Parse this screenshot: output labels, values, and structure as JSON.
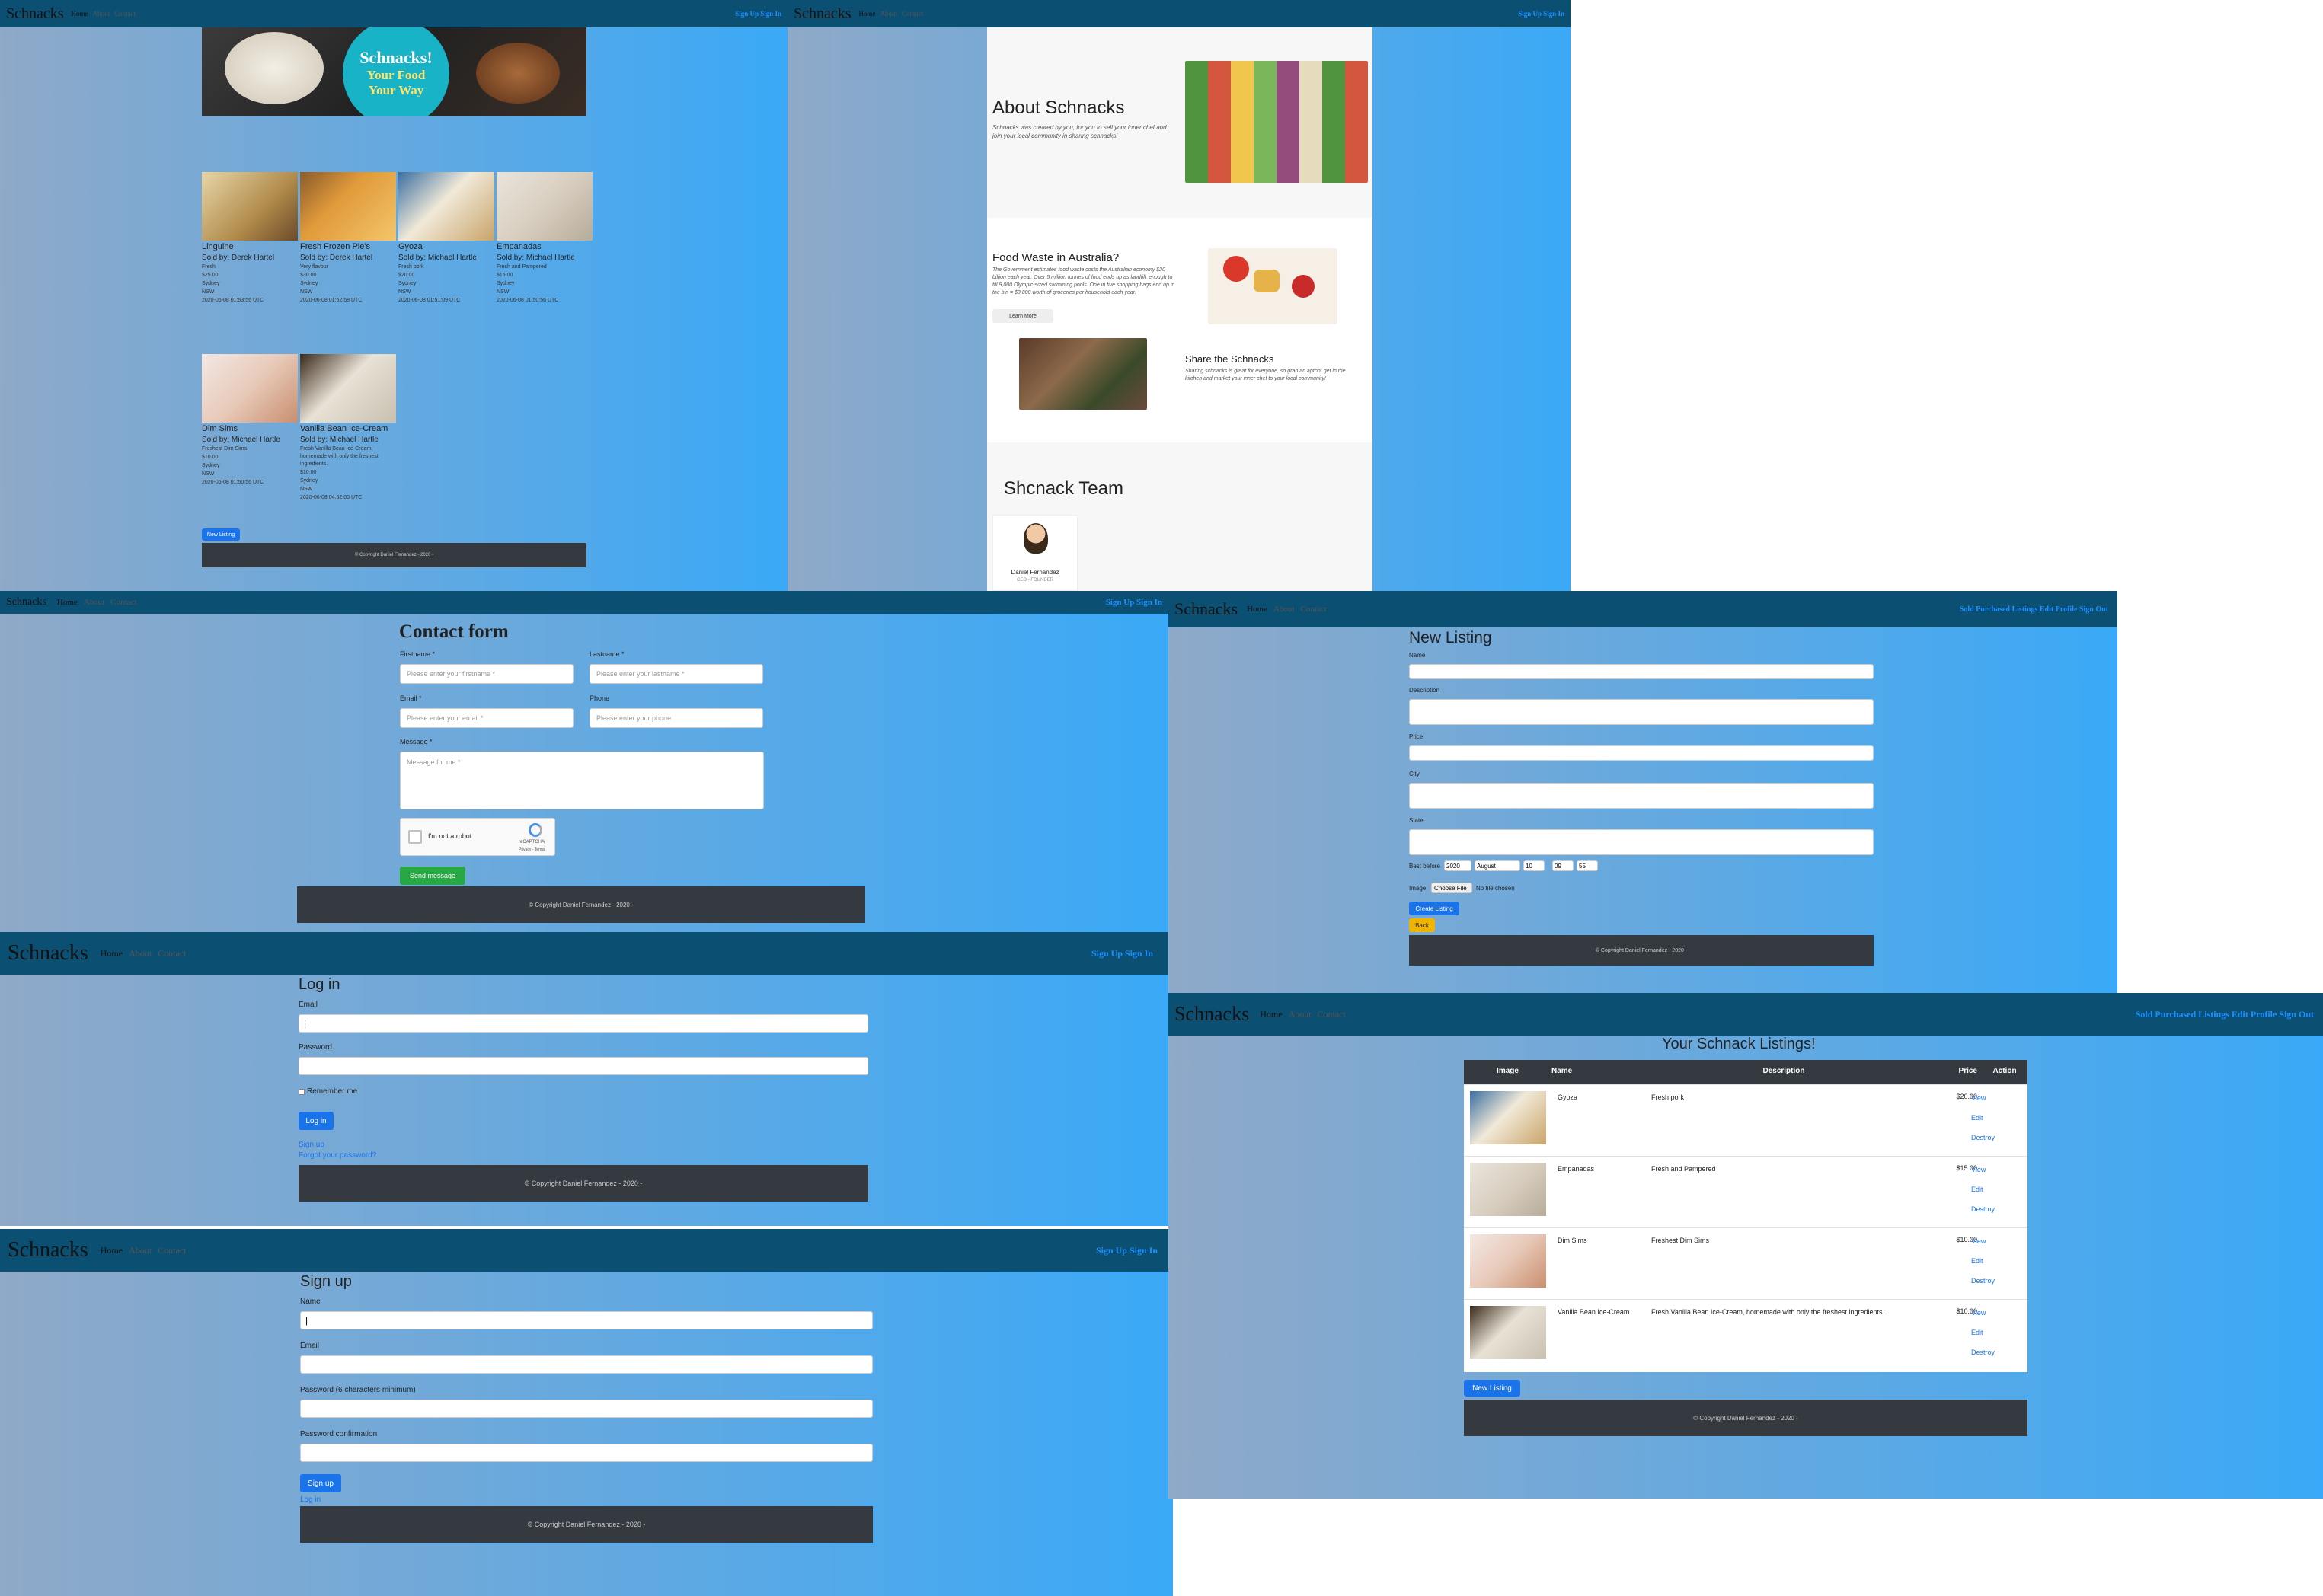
{
  "brand": "Schnacks",
  "nav": {
    "home": "Home",
    "about": "About",
    "contact": "Contact",
    "signup": "Sign Up",
    "signin": "Sign In",
    "auth_links": "Sign Up Sign In",
    "user_links": "Sold Purchased Listings Edit Profile Sign Out"
  },
  "home": {
    "banner_line1": "Schnacks!",
    "banner_line2": "Your Food",
    "banner_line3": "Your Way",
    "listings": [
      {
        "name": "Linguine",
        "seller": "Sold by: Derek Hartel",
        "desc": "Fresh",
        "price": "$25.00",
        "city": "Sydney",
        "state": "NSW",
        "date": "2020-06-08 01:53:56 UTC"
      },
      {
        "name": "Fresh Frozen Pie's",
        "seller": "Sold by: Derek Hartel",
        "desc": "Very flavour",
        "price": "$30.00",
        "city": "Sydney",
        "state": "NSW",
        "date": "2020-06-08 01:52:58 UTC"
      },
      {
        "name": "Gyoza",
        "seller": "Sold by: Michael Hartle",
        "desc": "Fresh pork",
        "price": "$20.00",
        "city": "Sydney",
        "state": "NSW",
        "date": "2020-06-08 01:51:09 UTC"
      },
      {
        "name": "Empanadas",
        "seller": "Sold by: Michael Hartle",
        "desc": "Fresh and Pampered",
        "price": "$15.00",
        "city": "Sydney",
        "state": "NSW",
        "date": "2020-06-08 01:50:56 UTC"
      },
      {
        "name": "Dim Sims",
        "seller": "Sold by: Michael Hartle",
        "desc": "Freshest Dim Sims",
        "price": "$10.00",
        "city": "Sydney",
        "state": "NSW",
        "date": "2020-06-08 01:50:56 UTC"
      },
      {
        "name": "Vanilla Bean Ice-Cream",
        "seller": "Sold by: Michael Hartle",
        "desc": "Fresh Vanilla Bean Ice-Cream, homemade with only the freshest ingredients.",
        "price": "$10.00",
        "city": "Sydney",
        "state": "NSW",
        "date": "2020-06-08 04:52:00 UTC"
      }
    ],
    "new_listing": "New Listing",
    "footer": "© Copyright Daniel Fernandez - 2020 -"
  },
  "about": {
    "title": "About Schnacks",
    "intro": "Schnacks was created by you, for you to sell your inner chef and join your local community in sharing schnacks!",
    "waste_title": "Food Waste in Australia?",
    "waste_text": "The Government estimates food waste costs the Australian economy $20 billion each year. Over 5 million tonnes of food ends up as landfill, enough to fill 9,000 Olympic-sized swimming pools. One in five shopping bags end up in the bin = $3,800 worth of groceries per household each year.",
    "learn_more": "Learn More",
    "share_title": "Share the Schnacks",
    "share_text": "Sharing schnacks is great for everyone, so grab an apron, get in the kitchen and market your inner chef to your local community!",
    "team_title": "Shcnack Team",
    "member_name": "Daniel Fernandez",
    "member_role": "CEO - FOUNDER"
  },
  "contact": {
    "title": "Contact form",
    "firstname_label": "Firstname *",
    "firstname_ph": "Please enter your firstname *",
    "lastname_label": "Lastname *",
    "lastname_ph": "Please enter your lastname *",
    "email_label": "Email *",
    "email_ph": "Please enter your email *",
    "phone_label": "Phone",
    "phone_ph": "Please enter your phone",
    "message_label": "Message *",
    "message_ph": "Message for me *",
    "captcha": "I'm not a robot",
    "captcha_brand": "reCAPTCHA",
    "captcha_terms": "Privacy - Terms",
    "send": "Send message"
  },
  "login": {
    "title": "Log in",
    "email": "Email",
    "password": "Password",
    "remember": "Remember me",
    "submit": "Log in",
    "signup_link": "Sign up",
    "forgot_link": "Forgot your password?"
  },
  "signup": {
    "title": "Sign up",
    "name": "Name",
    "email": "Email",
    "password": "Password (6 characters minimum)",
    "confirm": "Password confirmation",
    "submit": "Sign up",
    "login_link": "Log in"
  },
  "newlisting": {
    "title": "New Listing",
    "name": "Name",
    "description": "Description",
    "price": "Price",
    "city": "City",
    "state": "State",
    "best_before": "Best before",
    "year": "2020",
    "month": "August",
    "day": "10",
    "hour": "09",
    "minute": "55",
    "image": "Image",
    "choose": "Choose File",
    "no_file": "No file chosen",
    "create": "Create Listing",
    "back": "Back"
  },
  "mylistings": {
    "title": "Your Schnack Listings!",
    "headers": [
      "Image",
      "Name",
      "Description",
      "Price",
      "Action"
    ],
    "rows": [
      {
        "name": "Gyoza",
        "desc": "Fresh pork",
        "price": "$20.00"
      },
      {
        "name": "Empanadas",
        "desc": "Fresh and Pampered",
        "price": "$15.00"
      },
      {
        "name": "Dim Sims",
        "desc": "Freshest Dim Sims",
        "price": "$10.00"
      },
      {
        "name": "Vanilla Bean Ice-Cream",
        "desc": "Fresh Vanilla Bean Ice-Cream, homemade with only the freshest ingredients.",
        "price": "$10.00"
      }
    ],
    "view": "View",
    "edit": "Edit",
    "destroy": "Destroy",
    "new_listing": "New Listing"
  },
  "colors": {
    "nav": "#0b4f73",
    "footer": "#343a40",
    "primary": "#1a73e8",
    "success": "#28a745",
    "warning": "#f0b400"
  }
}
